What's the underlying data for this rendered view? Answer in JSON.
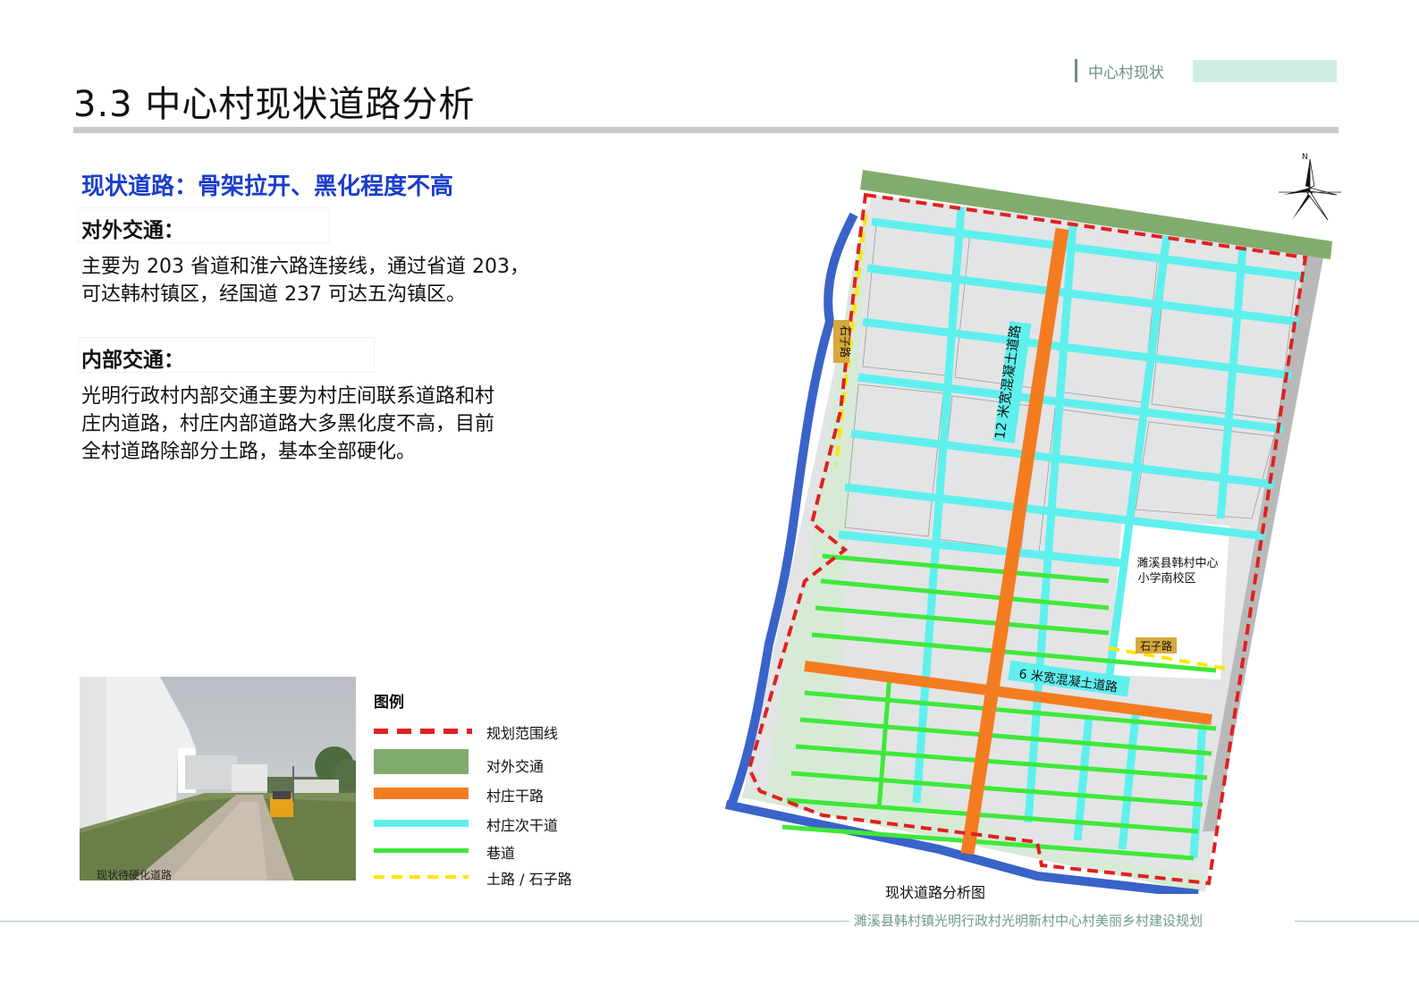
{
  "header": {
    "title": "3.3 中心村现状道路分析",
    "section_tag": "中心村现状"
  },
  "content": {
    "subtitle": "现状道路：骨架拉开、黑化程度不高",
    "external_heading": "对外交通：",
    "external_text_1": "主要为 203 省道和淮六路连接线，通过省道 203，",
    "external_text_2": "可达韩村镇区，经国道 237 可达五沟镇区。",
    "internal_heading": "内部交通：",
    "internal_text_1": "光明行政村内部交通主要为村庄间联系道路和村",
    "internal_text_2": "庄内道路，村庄内部道路大多黑化度不高，目前",
    "internal_text_3": "全村道路除部分土路，基本全部硬化。"
  },
  "photo": {
    "caption": "现状待硬化道路"
  },
  "legend": {
    "title": "图例",
    "items": [
      {
        "label": "规划范围线",
        "color": "#e02020",
        "icon": "dashed-line"
      },
      {
        "label": "对外交通",
        "color": "#82ac6e",
        "icon": "solid-block"
      },
      {
        "label": "村庄干路",
        "color": "#f47c20",
        "icon": "solid-line"
      },
      {
        "label": "村庄次干道",
        "color": "#5ff0ee",
        "icon": "solid-line"
      },
      {
        "label": "巷道",
        "color": "#3fe83a",
        "icon": "solid-line"
      },
      {
        "label": "土路 / 石子路",
        "color": "#ffe600",
        "icon": "dashed-line"
      }
    ]
  },
  "map": {
    "label_road_12m": "12 米宽混凝土道路",
    "label_road_6m": "6 米宽混凝土道路",
    "label_school": "濉溪县韩村中心",
    "label_school_2": "小学南校区",
    "label_stone_road": "石子路",
    "label_stone_road_v": "石子路",
    "caption": "现状道路分析图",
    "north_letter": "N"
  },
  "footer": {
    "text": "濉溪县韩村镇光明行政村光明新村中心村美丽乡村建设规划"
  }
}
